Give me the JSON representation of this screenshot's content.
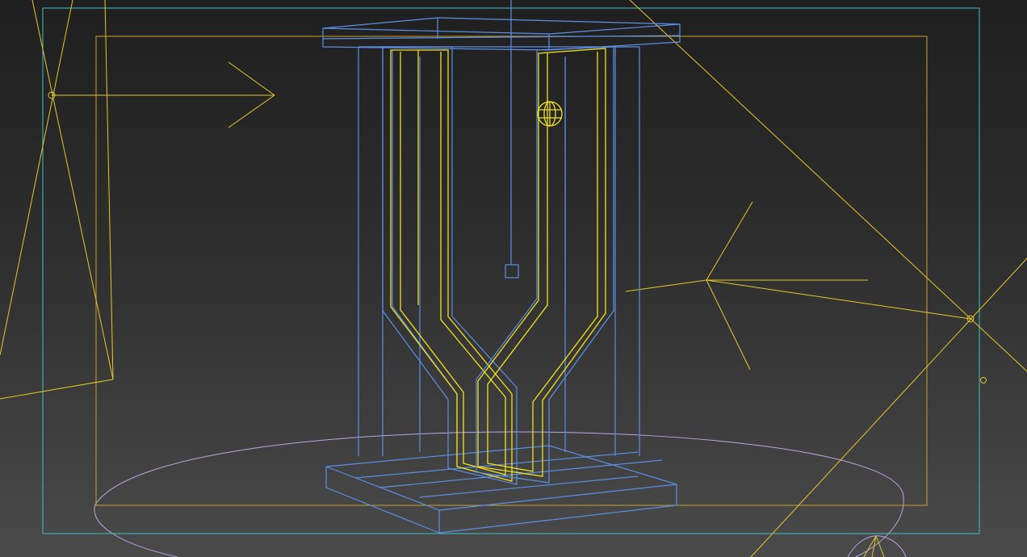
{
  "viewport": {
    "view": "perspective",
    "background": "#2b2b2b"
  },
  "colors": {
    "object_wire": "#5b8fe6",
    "selected_wire": "#f2e21c",
    "light_wire": "#e6c82a",
    "safe_frame": "#c9a227",
    "render_frame": "#3cc4c8",
    "floor_ellipse": "#b9a6e6"
  },
  "scene_objects": [
    {
      "name": "container-box",
      "icon": "box-icon"
    },
    {
      "name": "top-lid-plate",
      "icon": "box-icon"
    },
    {
      "name": "base-plate",
      "icon": "box-icon"
    },
    {
      "name": "y-pipe-left",
      "icon": "spline-icon"
    },
    {
      "name": "y-pipe-right",
      "icon": "spline-icon"
    },
    {
      "name": "light-target-sphere",
      "icon": "sphere-icon"
    },
    {
      "name": "hanging-helper",
      "icon": "helper-icon"
    },
    {
      "name": "spot-light-left",
      "icon": "light-icon"
    },
    {
      "name": "spot-light-right",
      "icon": "light-icon"
    },
    {
      "name": "floor-disc",
      "icon": "cylinder-icon"
    }
  ]
}
